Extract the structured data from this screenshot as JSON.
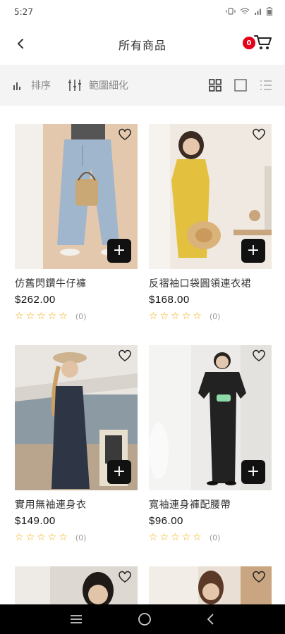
{
  "status_bar": {
    "time": "5:27"
  },
  "header": {
    "title": "所有商品",
    "cart_count": "0"
  },
  "toolbar": {
    "sort_label": "排序",
    "filter_label": "範圍細化"
  },
  "products": [
    {
      "name": "仿舊閃鑽牛仔褲",
      "price": "$262.00",
      "reviews": "(0)"
    },
    {
      "name": "反褶袖口袋圓領連衣裙",
      "price": "$168.00",
      "reviews": "(0)"
    },
    {
      "name": "實用無袖連身衣",
      "price": "$149.00",
      "reviews": "(0)"
    },
    {
      "name": "寬袖連身褲配腰帶",
      "price": "$96.00",
      "reviews": "(0)"
    },
    {
      "name": "",
      "price": "",
      "reviews": ""
    },
    {
      "name": "",
      "price": "",
      "reviews": ""
    }
  ],
  "colors": {
    "accent": "#e3001b",
    "star": "#f2a900",
    "toolbar_bg": "#f4f4f4"
  },
  "icons": {
    "back": "chevron-left-icon",
    "cart": "cart-icon",
    "sort": "bar-chart-icon",
    "filter": "sliders-icon",
    "grid": "grid-icon",
    "single": "square-icon",
    "list": "list-icon",
    "favorite": "heart-icon",
    "add": "plus-icon"
  }
}
